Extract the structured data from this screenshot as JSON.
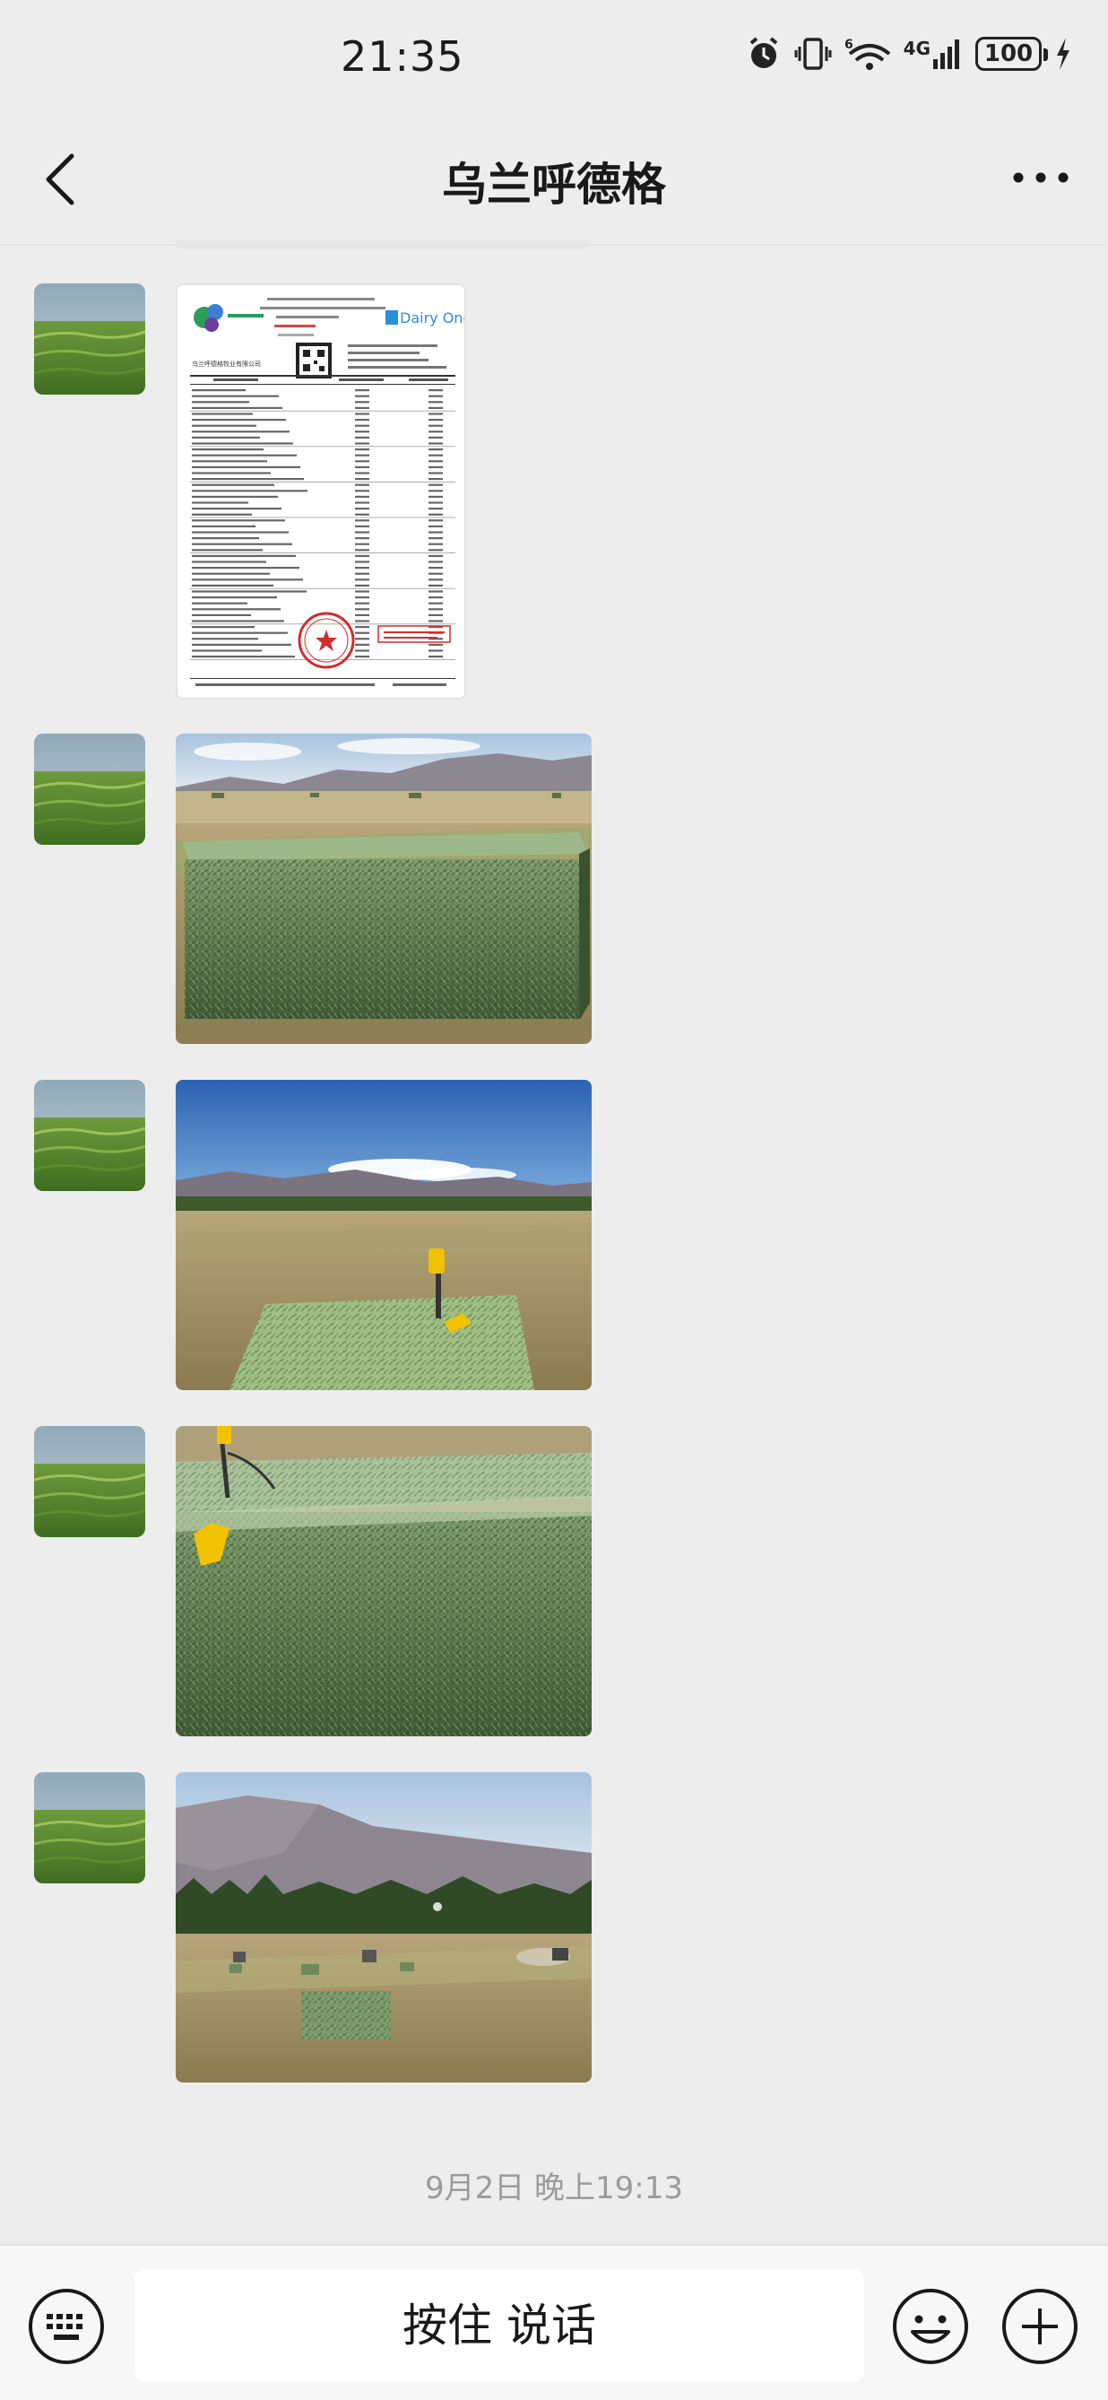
{
  "status_bar": {
    "time": "21:35",
    "network_label": "4G",
    "battery": "100",
    "icons": [
      "alarm-icon",
      "vibrate-icon",
      "wifi-icon",
      "signal-icon",
      "battery-icon",
      "charging-icon"
    ]
  },
  "header": {
    "title": "乌兰呼德格",
    "back_icon": "chevron-left-icon",
    "more_icon": "more-dots-icon"
  },
  "report": {
    "logo_text": "Dairy One",
    "company_line": "乌兰呼德格牧业有限公司"
  },
  "messages": [
    {
      "type": "image",
      "content": "forage test report document with red seal"
    },
    {
      "type": "image",
      "content": "large square alfalfa hay bale in field, mountains behind"
    },
    {
      "type": "image",
      "content": "baled field with yellow moisture probe, blue sky and mountains"
    },
    {
      "type": "image",
      "content": "close-up of green hay bale with yellow probe"
    },
    {
      "type": "image",
      "content": "harvested field with bales, trees and mountains"
    }
  ],
  "timestamp": "9月2日 晚上19:13",
  "input_bar": {
    "talk_label": "按住 说话",
    "keyboard_icon": "keyboard-icon",
    "emoji_icon": "emoji-icon",
    "plus_icon": "plus-icon"
  },
  "colors": {
    "background": "#ededed",
    "input_bar": "#f7f7f7",
    "seal_red": "#d62b2b",
    "dairy_one_blue": "#2d8fd6"
  }
}
